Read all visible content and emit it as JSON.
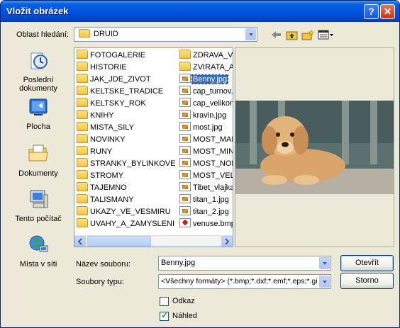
{
  "window": {
    "title": "Vložit obrázek"
  },
  "lookin": {
    "label": "Oblast hledání:",
    "value": "DRUID"
  },
  "places": [
    {
      "label": "Poslední dokumenty",
      "icon": "recent-documents-icon"
    },
    {
      "label": "Plocha",
      "icon": "desktop-icon"
    },
    {
      "label": "Dokumenty",
      "icon": "my-documents-icon"
    },
    {
      "label": "Tento počítač",
      "icon": "my-computer-icon"
    },
    {
      "label": "Místa v síti",
      "icon": "network-places-icon"
    }
  ],
  "files_col1": [
    {
      "name": "FOTOGALERIE",
      "kind": "folder"
    },
    {
      "name": "HISTORIE",
      "kind": "folder"
    },
    {
      "name": "JAK_JDE_ZIVOT",
      "kind": "folder"
    },
    {
      "name": "KELTSKE_TRADICE",
      "kind": "folder"
    },
    {
      "name": "KELTSKY_ROK",
      "kind": "folder"
    },
    {
      "name": "KNIHY",
      "kind": "folder"
    },
    {
      "name": "MISTA_SILY",
      "kind": "folder"
    },
    {
      "name": "NOVINKY",
      "kind": "folder"
    },
    {
      "name": "RUNY",
      "kind": "folder"
    },
    {
      "name": "STRANKY_BYLINKOVE",
      "kind": "folder"
    },
    {
      "name": "STROMY",
      "kind": "folder"
    },
    {
      "name": "TAJEMNO",
      "kind": "folder"
    },
    {
      "name": "TALISMANY",
      "kind": "folder"
    },
    {
      "name": "UKAZY_VE_VESMIRU",
      "kind": "folder"
    },
    {
      "name": "UVAHY_A_ZAMYSLENI",
      "kind": "folder"
    }
  ],
  "files_col2": [
    {
      "name": "ZDRAVA_VY",
      "kind": "folder"
    },
    {
      "name": "ZVIRATA_A_",
      "kind": "folder"
    },
    {
      "name": "Benny.jpg",
      "kind": "image",
      "selected": true
    },
    {
      "name": "cap_turnov.",
      "kind": "image"
    },
    {
      "name": "cap_velikonc",
      "kind": "image"
    },
    {
      "name": "kravin.jpg",
      "kind": "image"
    },
    {
      "name": "most.jpg",
      "kind": "image"
    },
    {
      "name": "MOST_MALE",
      "kind": "image"
    },
    {
      "name": "MOST_MINI",
      "kind": "image"
    },
    {
      "name": "MOST_NORM",
      "kind": "image"
    },
    {
      "name": "MOST_VELKI",
      "kind": "image"
    },
    {
      "name": "Tibet_vlajka",
      "kind": "image"
    },
    {
      "name": "titan_1.jpg",
      "kind": "image"
    },
    {
      "name": "titan_2.jpg",
      "kind": "image"
    },
    {
      "name": "venuse.bmp",
      "kind": "vector"
    }
  ],
  "filename": {
    "label": "Název souboru:",
    "value": "Benny.jpg"
  },
  "filetype": {
    "label": "Soubory typu:",
    "value": "<Všechny formáty> (*.bmp;*.dxf;*.emf;*.eps;*.gif"
  },
  "buttons": {
    "open": "Otevřít",
    "cancel": "Storno"
  },
  "checkboxes": {
    "link": {
      "label": "Odkaz",
      "checked": false
    },
    "preview": {
      "label": "Náhled",
      "checked": true
    }
  }
}
